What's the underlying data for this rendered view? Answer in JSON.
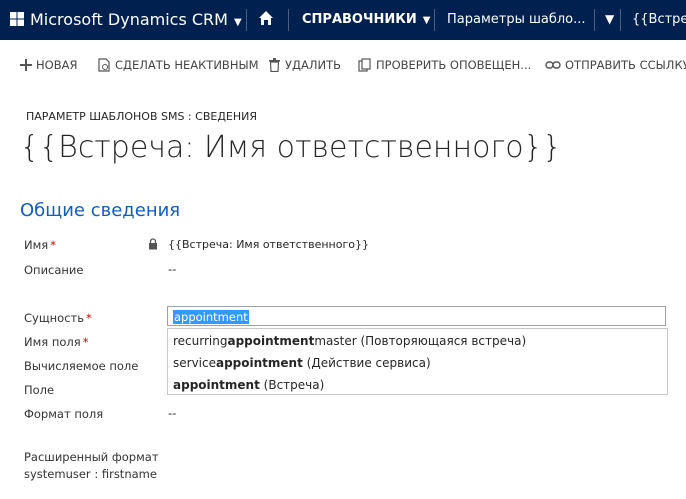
{
  "topbar": {
    "brand": "Microsoft Dynamics CRM",
    "nav1": "СПРАВОЧНИКИ",
    "nav2": "Параметры шабло...",
    "nav4": "{{Встреча"
  },
  "commands": {
    "new": "НОВАЯ",
    "deactivate": "СДЕЛАТЬ НЕАКТИВНЫМ",
    "delete": "УДАЛИТЬ",
    "check": "ПРОВЕРИТЬ ОПОВЕЩЕН...",
    "send_link": "ОТПРАВИТЬ ССЫЛКУ"
  },
  "header": {
    "breadcrumb": "ПАРАМЕТР ШАБЛОНОВ SMS : СВЕДЕНИЯ",
    "title": "{{Встреча: Имя ответственного}}"
  },
  "section_title": "Общие сведения",
  "fields": {
    "name_label": "Имя",
    "name_value": "{{Встреча: Имя ответственного}}",
    "description_label": "Описание",
    "description_value": "--",
    "entity_label": "Сущность",
    "entity_value": "appointment",
    "field_name_label": "Имя поля",
    "computed_label": "Вычисляемое поле",
    "field_label": "Поле",
    "format_label": "Формат поля",
    "format_value": "--",
    "extended_label": "Расширенный формат",
    "extended_value": "systemuser : firstname"
  },
  "dropdown": [
    {
      "pre": "recurring",
      "bold": "appointment",
      "post": "master (Повторяющаяся встреча)"
    },
    {
      "pre": "service",
      "bold": "appointment",
      "post": " (Действие сервиса)"
    },
    {
      "pre": "",
      "bold": "appointment",
      "post": " (Встреча)"
    }
  ],
  "colors": {
    "topbar": "#002050",
    "section": "#1160b7",
    "selection": "#3399ff",
    "required": "#cc0000"
  }
}
